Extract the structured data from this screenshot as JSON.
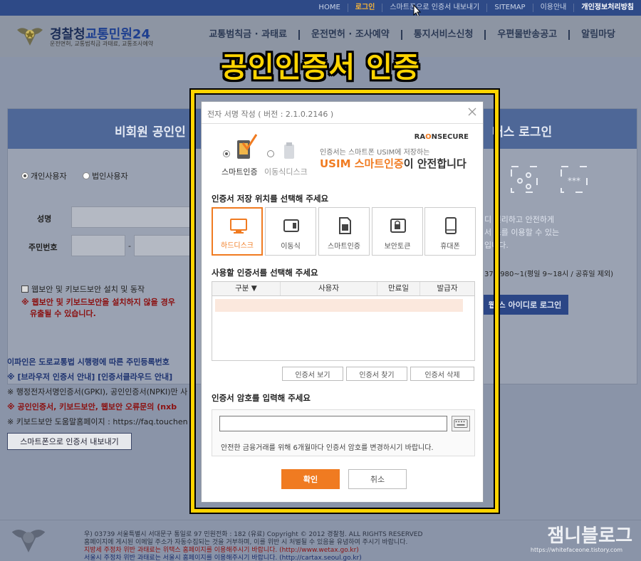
{
  "topnav": {
    "items": [
      "HOME",
      "로그인",
      "스마트폰으로 인증서 내보내기",
      "SITEMAP",
      "이용안내",
      "개인정보처리방침"
    ]
  },
  "header": {
    "logo_title_a": "경찰청",
    "logo_title_b": "교통민원24",
    "logo_sub": "운전면허, 교통범칙금 과태료, 교통조사예약",
    "menu": [
      "교통범칙금 · 과태료",
      "운전면허 · 조사예약",
      "통지서비스신청",
      "우편물반송공고",
      "알림마당"
    ]
  },
  "caption": "공인인증서 인증",
  "background": {
    "panel_left_title": "비회원 공인인",
    "panel_right_title": "대스 로그인",
    "radio_personal": "개인사용자",
    "radio_corp": "법인사용자",
    "label_name": "성명",
    "label_rrn": "주민번호",
    "rrn_dash": "-",
    "web_security": "웹보안 및 키보드보안 설치 및 동작",
    "warn1": "※ 웹보안 및 키보드보안을 설치하지 않을 경우",
    "warn2": "유출될 수 있습니다.",
    "right_text1": "디 편리하고 안전하게",
    "right_text2": "서 스를 이용할 수 있는",
    "right_text3": "입니다.",
    "right_phone": "37 0980~1(평일 9~18시 / 공휴일 제외)",
    "right_btn": "웹 스 아이디로 로그인",
    "notice1": "이파인은 도로교통법 시행령에 따른 주민등록번호",
    "notice2": "※ [브라우저 인증서 안내] [인증서클라우드 안내]",
    "notice3": "※ 행정전자서명인증서(GPKI), 공인인증서(NPKI)만 사",
    "notice4": "※ 공인인증서, 키보드보안, 웹보안 오류문의 (nxb",
    "notice5": "※ 키보드보안 도움말홈페이지 : https://faq.touchen",
    "export_btn": "스마트폰으로 인증서 내보내기"
  },
  "footer": {
    "line1": "우) 03739 서울특별시 서대문구 통일로 97  민원전화 : 182 (유료)          Copyright © 2012 경찰청. ALL RIGHTS RESERVED",
    "line2": "홈페이지에 게시된 이메일 주소가 자동수집되는 것을 거부하며, 이를 위반 시 처벌될 수 있음을 유념하여 주시기 바랍니다.",
    "line3": "지방세 주정차 위반 과태료는 위택스 홈페이지를 이용해주시기 바랍니다. (http://www.wetax.go.kr)",
    "line4": "서울시 주정차 위반 과태료는 서울시 홈페이지를 이용해주시기 바랍니다. (http://cartax.seoul.go.kr)",
    "watermark": "잼니블로그",
    "watermark_sub": "https://whitefaceone.tistory.com"
  },
  "dialog": {
    "title": "전자 서명 작성 ( 버전 : 2.1.0.2146 )",
    "option_smart": "스마트인증",
    "option_removable": "이동식디스크",
    "brand_a": "RA",
    "brand_o": "O",
    "brand_b": "NSECURE",
    "ad_line1": "인증서는 스마트폰 USIM에 저장하는",
    "ad_line2_a": "USIM 스마트인증",
    "ad_line2_b": "이 안전합니다",
    "section_location": "인증서 저장 위치를 선택해 주세요",
    "locations": [
      "하드디스크",
      "이동식",
      "스마트인증",
      "보안토큰",
      "휴대폰"
    ],
    "section_select": "사용할 인증서를 선택해 주세요",
    "table_headers": [
      "구분 ▼",
      "사용자",
      "만료일",
      "발급자"
    ],
    "btn_view": "인증서 보기",
    "btn_find": "인증서 찾기",
    "btn_delete": "인증서 삭제",
    "section_password": "인증서 암호를 입력해 주세요",
    "password_value": "",
    "password_note": "안전한 금융거래를 위해 6개월마다 인증서 암호를 변경하시기 바랍니다.",
    "ok": "확인",
    "cancel": "취소"
  }
}
